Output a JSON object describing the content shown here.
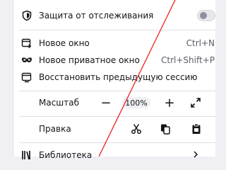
{
  "menu": {
    "tracking": {
      "label": "Защита от отслеживания"
    },
    "new_window": {
      "label": "Новое окно",
      "shortcut": "Ctrl+N"
    },
    "new_private": {
      "label": "Новое приватное окно",
      "shortcut": "Ctrl+Shift+P"
    },
    "restore": {
      "label": "Восстановить предыдущую сессию"
    },
    "zoom": {
      "label": "Масштаб",
      "value": "100%",
      "minus": "−",
      "plus": "+"
    },
    "edit": {
      "label": "Правка"
    },
    "library": {
      "label": "Библиотека"
    }
  },
  "watermark_line_color": "#e8312f"
}
